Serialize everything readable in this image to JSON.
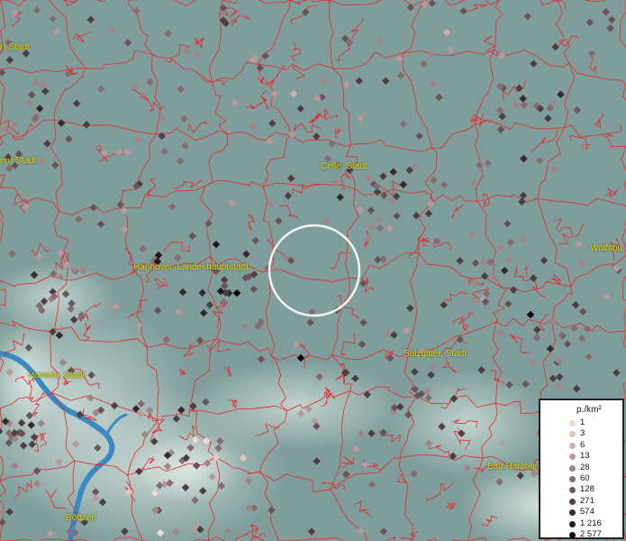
{
  "map": {
    "colors": {
      "lowland": "#7f9e9b",
      "upland": "#b8cbc8",
      "water": "#3b89c2",
      "boundary": "#e8282a",
      "label": "#e8d800",
      "selection_ring": "#ffffff"
    },
    "cities": [
      {
        "id": "stadt-nw",
        "label": "r) Stadt"
      },
      {
        "id": "stadt-w",
        "label": "en) Stadt"
      },
      {
        "id": "celle",
        "label": "Celle, Stadt"
      },
      {
        "id": "hannover",
        "label": "Hannover, Landeshauptstadt"
      },
      {
        "id": "wolfsburg",
        "label": "Wolfsbu"
      },
      {
        "id": "hameln",
        "label": "Hameln, Stadt"
      },
      {
        "id": "salzgitter",
        "label": "Salzgitter, Stadt"
      },
      {
        "id": "bad-harzburg",
        "label": "Bad Harzbur"
      },
      {
        "id": "bodenwerder",
        "label": "Böttzen"
      }
    ],
    "legend": {
      "title": "p./km²",
      "classes": [
        {
          "label": "1",
          "color": "#f0d8d8"
        },
        {
          "label": "3",
          "color": "#e0c4c4"
        },
        {
          "label": "6",
          "color": "#cdb0b2"
        },
        {
          "label": "13",
          "color": "#b89a9c"
        },
        {
          "label": "28",
          "color": "#a08488"
        },
        {
          "label": "60",
          "color": "#866c70"
        },
        {
          "label": "128",
          "color": "#6a5458"
        },
        {
          "label": "271",
          "color": "#4e3e42"
        },
        {
          "label": "574",
          "color": "#36292c"
        },
        {
          "label": "1 216",
          "color": "#201a1c"
        },
        {
          "label": "2 577",
          "color": "#0a0808"
        }
      ]
    }
  }
}
